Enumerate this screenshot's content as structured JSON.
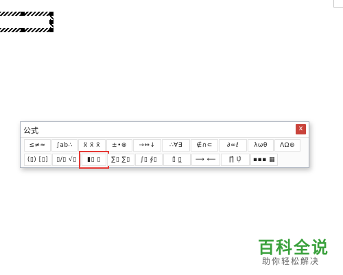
{
  "window": {
    "title": "公式",
    "close_label": "x"
  },
  "palette": {
    "row1": [
      {
        "name": "relations-palette",
        "label": "≤≠≈"
      },
      {
        "name": "spaces-ellipses-palette",
        "label": "∫ab∴"
      },
      {
        "name": "embellishments-palette",
        "label": "ẍ ẍ ẍ"
      },
      {
        "name": "operators-palette",
        "label": "±•⊗"
      },
      {
        "name": "arrows-palette",
        "label": "→⇔↓"
      },
      {
        "name": "logic-palette",
        "label": "∴∀∃"
      },
      {
        "name": "set-theory-palette",
        "label": "∉∩⊂"
      },
      {
        "name": "misc-symbols-palette",
        "label": "∂∞ℓ"
      },
      {
        "name": "greek-lowercase-palette",
        "label": "λωθ"
      },
      {
        "name": "greek-uppercase-palette",
        "label": "ΛΩ⊛"
      }
    ],
    "row2": [
      {
        "name": "fence-templates-palette",
        "label": "(▯) [▯]"
      },
      {
        "name": "fraction-radical-templates-palette",
        "label": "▯/▯ √▯"
      },
      {
        "name": "subscript-superscript-templates-palette",
        "label": "▮▯ ▯"
      },
      {
        "name": "summation-templates-palette",
        "label": "∑▯ ∑▯"
      },
      {
        "name": "integral-templates-palette",
        "label": "∫▯ ∮▯"
      },
      {
        "name": "underbar-overbar-templates-palette",
        "label": "▯̄ ▯̲"
      },
      {
        "name": "labeled-arrow-templates-palette",
        "label": "⟶ ⟵"
      },
      {
        "name": "products-set-templates-palette",
        "label": "∏̂ Ụ̂"
      },
      {
        "name": "matrix-templates-palette",
        "label": "▪▪▪ ▦"
      }
    ],
    "highlight_color": "#e53935"
  },
  "watermark": {
    "title": "百科全说",
    "subtitle": "助你轻松解决"
  }
}
